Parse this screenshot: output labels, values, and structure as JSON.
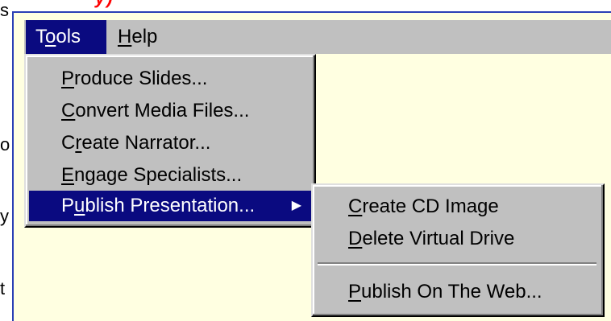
{
  "background_text": {
    "heading_fragment": "y)",
    "margin_fragments": [
      "s",
      "o",
      "y",
      "t"
    ]
  },
  "menubar": {
    "tools": {
      "pre": "T",
      "key": "o",
      "post": "ols"
    },
    "help": {
      "pre": "",
      "key": "H",
      "post": "elp"
    }
  },
  "tools_menu": {
    "items": [
      {
        "pre": "",
        "key": "P",
        "post": "roduce Slides..."
      },
      {
        "pre": "",
        "key": "C",
        "post": "onvert Media Files..."
      },
      {
        "pre": "C",
        "key": "r",
        "post": "eate Narrator..."
      },
      {
        "pre": "",
        "key": "E",
        "post": "ngage Specialists..."
      },
      {
        "pre": "P",
        "key": "u",
        "post": "blish Presentation...",
        "has_submenu": true,
        "selected": true
      }
    ]
  },
  "submenu": {
    "items": [
      {
        "pre": "",
        "key": "C",
        "post": "reate CD Image"
      },
      {
        "pre": "",
        "key": "D",
        "post": "elete Virtual Drive"
      },
      {
        "pre": "",
        "key": "P",
        "post": "ublish On The Web..."
      }
    ]
  },
  "colors": {
    "highlight": "#0a0a80",
    "menu_bg": "#c0c0c0",
    "panel_bg": "#ffffe1",
    "panel_border": "#2a3fb5",
    "heading_red": "#ff0000"
  },
  "icons": {
    "submenu_arrow": "triangle-right-icon"
  }
}
